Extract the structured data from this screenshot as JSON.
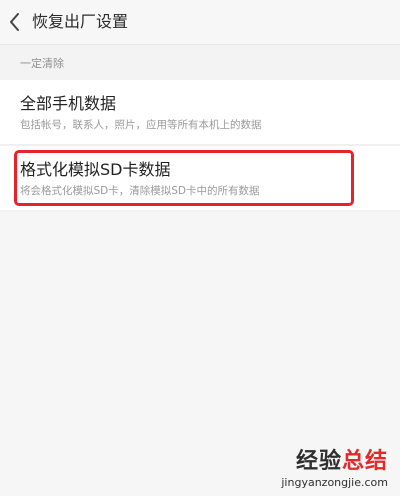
{
  "header": {
    "title": "恢复出厂设置"
  },
  "section": {
    "label": "一定清除"
  },
  "items": [
    {
      "title": "全部手机数据",
      "subtitle": "包括帐号，联系人，照片，应用等所有本机上的数据"
    },
    {
      "title": "格式化模拟SD卡数据",
      "subtitle": "将会格式化模拟SD卡，清除模拟SD卡中的所有数据"
    }
  ],
  "watermark": {
    "brand_part1": "经验",
    "brand_part2": "总结",
    "url": "jingyanzongjie.com"
  },
  "colors": {
    "highlight": "#e6232a",
    "brand_red": "#e02b2b"
  }
}
